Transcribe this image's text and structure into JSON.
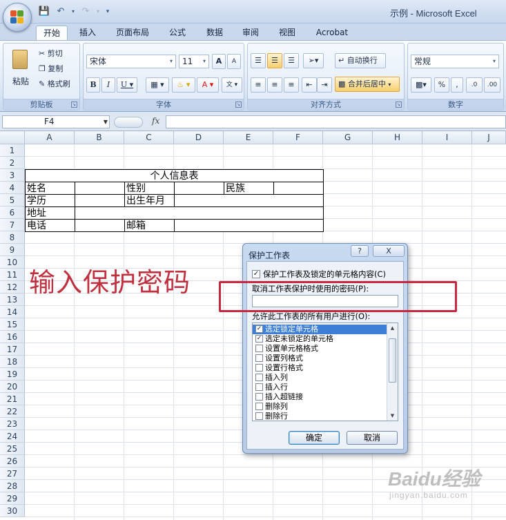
{
  "window": {
    "title": "示例 - Microsoft Excel"
  },
  "qat": {
    "save_icon": "save-icon",
    "undo_icon": "undo-icon",
    "redo_icon": "redo-icon"
  },
  "tabs": [
    {
      "label": "开始",
      "active": true
    },
    {
      "label": "插入"
    },
    {
      "label": "页面布局"
    },
    {
      "label": "公式"
    },
    {
      "label": "数据"
    },
    {
      "label": "审阅"
    },
    {
      "label": "视图"
    },
    {
      "label": "Acrobat"
    }
  ],
  "ribbon": {
    "clipboard": {
      "label": "剪贴板",
      "paste": "粘贴",
      "cut": "剪切",
      "copy": "复制",
      "format_painter": "格式刷"
    },
    "font": {
      "label": "字体",
      "font_name": "宋体",
      "font_size": "11"
    },
    "alignment": {
      "label": "对齐方式",
      "wrap_text": "自动换行",
      "merge_center": "合并后居中"
    },
    "number": {
      "label": "数字",
      "format": "常规"
    }
  },
  "formula_bar": {
    "name_box": "F4",
    "fx": "fx",
    "formula": ""
  },
  "sheet": {
    "columns": [
      "A",
      "B",
      "C",
      "D",
      "E",
      "F",
      "G",
      "H",
      "I",
      "J"
    ],
    "rows": [
      "1",
      "2",
      "3",
      "4",
      "5",
      "6",
      "7",
      "8",
      "9",
      "10",
      "11",
      "12",
      "13",
      "14",
      "15",
      "16",
      "17",
      "18",
      "19",
      "20",
      "21",
      "22",
      "23",
      "24",
      "25",
      "26",
      "27",
      "28",
      "29",
      "30"
    ],
    "table": {
      "title": "个人信息表",
      "name": "姓名",
      "gender": "性别",
      "ethnicity": "民族",
      "education": "学历",
      "birth": "出生年月",
      "address": "地址",
      "phone": "电话",
      "email": "邮箱"
    }
  },
  "annotation": {
    "text": "输入保护密码",
    "color": "#c0303f"
  },
  "dialog": {
    "title": "保护工作表",
    "help": "?",
    "close": "X",
    "protect_label": "保护工作表及锁定的单元格内容(C)",
    "protect_checked": true,
    "password_label": "取消工作表保护时使用的密码(P):",
    "password_value": "",
    "allow_label": "允许此工作表的所有用户进行(O):",
    "permissions": [
      {
        "label": "选定锁定单元格",
        "checked": true,
        "selected": true
      },
      {
        "label": "选定未锁定的单元格",
        "checked": true
      },
      {
        "label": "设置单元格格式",
        "checked": false
      },
      {
        "label": "设置列格式",
        "checked": false
      },
      {
        "label": "设置行格式",
        "checked": false
      },
      {
        "label": "插入列",
        "checked": false
      },
      {
        "label": "插入行",
        "checked": false
      },
      {
        "label": "插入超链接",
        "checked": false
      },
      {
        "label": "删除列",
        "checked": false
      },
      {
        "label": "删除行",
        "checked": false
      }
    ],
    "ok": "确定",
    "cancel": "取消"
  },
  "watermark": {
    "main": "Baidu经验",
    "sub": "jingyan.baidu.com"
  }
}
